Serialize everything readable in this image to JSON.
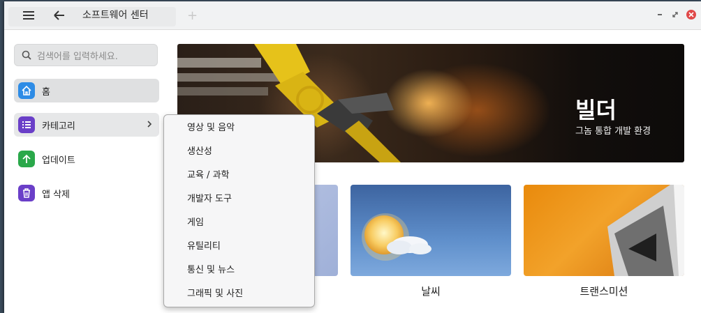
{
  "window": {
    "title": "소프트웨어 센터"
  },
  "sidebar": {
    "search_placeholder": "검색어를 입력하세요.",
    "items": [
      {
        "label": "홈",
        "icon": "home-icon",
        "color": "#2e8ce6"
      },
      {
        "label": "카테고리",
        "icon": "list-icon",
        "color": "#6a3fc8"
      },
      {
        "label": "업데이트",
        "icon": "arrow-up-icon",
        "color": "#2aa84a"
      },
      {
        "label": "앱 삭제",
        "icon": "trash-icon",
        "color": "#6a3fc8"
      }
    ]
  },
  "banner": {
    "title": "빌더",
    "subtitle": "그놈 통합 개발 환경"
  },
  "tiles": [
    {
      "label": ""
    },
    {
      "label": "날씨"
    },
    {
      "label": "트랜스미션"
    }
  ],
  "category_menu": {
    "items": [
      "영상 및 음악",
      "생산성",
      "교육 / 과학",
      "개발자 도구",
      "게임",
      "유틸리티",
      "통신 및 뉴스",
      "그래픽 및 사진"
    ]
  },
  "colors": {
    "close_button": "#e04848",
    "menu_border": "#a9a9a9"
  }
}
